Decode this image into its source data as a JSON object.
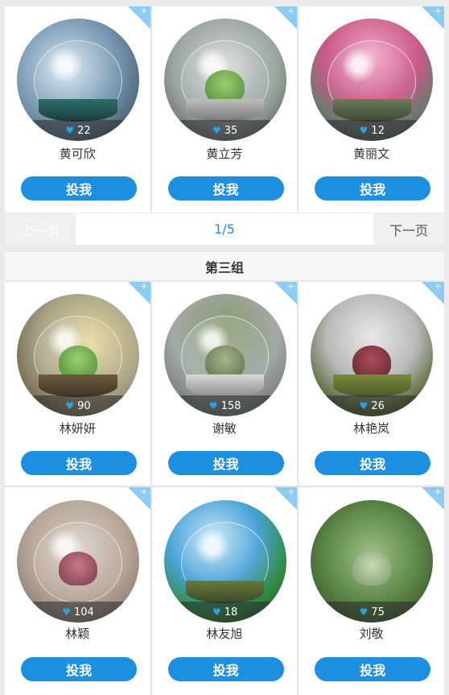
{
  "group_title": "第三组",
  "pager": {
    "prev": "上一页",
    "page": "1/5",
    "next": "下一页"
  },
  "vote_label": "投我",
  "corner_symbol": "+",
  "heart_icon": "♥",
  "colors": {
    "accent": "#1d8fe0",
    "corner": "#8ecbf0",
    "heart": "#29a3e8"
  },
  "top_entries": [
    {
      "name": "黄可欣",
      "likes": "22"
    },
    {
      "name": "黄立芳",
      "likes": "35"
    },
    {
      "name": "黄丽文",
      "likes": "12"
    }
  ],
  "group3_row1": [
    {
      "name": "林妍妍",
      "likes": "90"
    },
    {
      "name": "谢敏",
      "likes": "158"
    },
    {
      "name": "林艳岚",
      "likes": "26"
    }
  ],
  "group3_row2": [
    {
      "name": "林颖",
      "likes": "104"
    },
    {
      "name": "林友旭",
      "likes": "18"
    },
    {
      "name": "刘敬",
      "likes": "75"
    }
  ]
}
